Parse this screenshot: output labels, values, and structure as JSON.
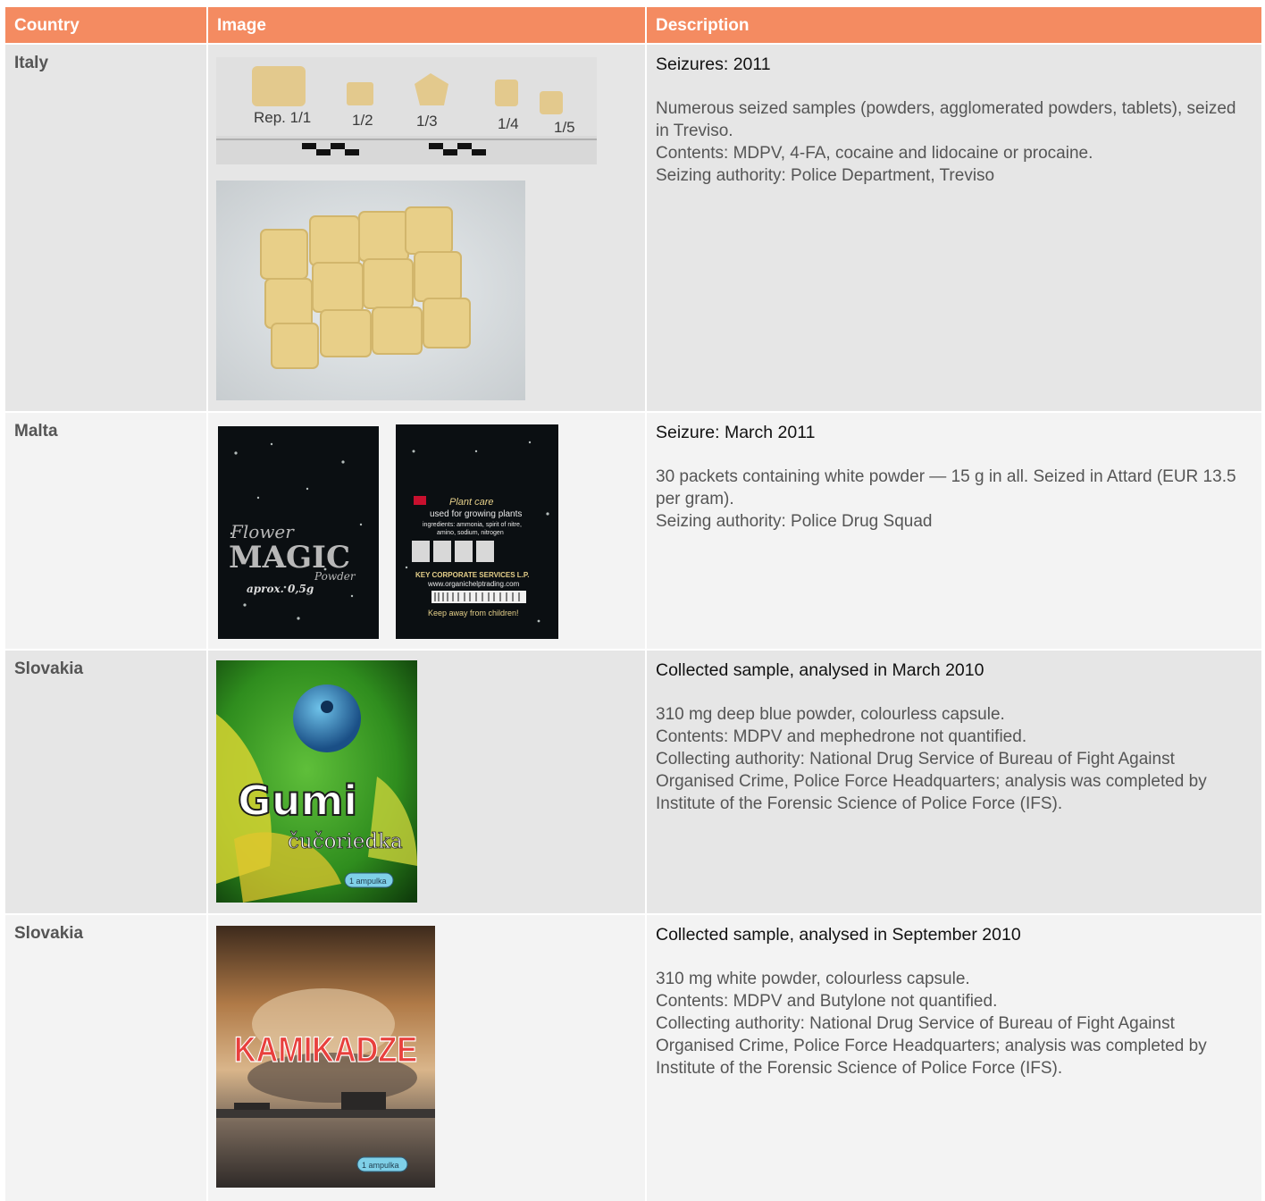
{
  "header": {
    "country": "Country",
    "image": "Image",
    "description": "Description"
  },
  "rows": [
    {
      "country": "Italy",
      "title": "Seizures: 2011",
      "body": "Numerous seized samples (powders, agglomerated powders, tablets), seized in Treviso.\nContents: MDPV, 4-FA, cocaine and lidocaine or procaine.\nSeizing authority: Police Department, Treviso",
      "images": {
        "labels": [
          "Rep. 1/1",
          "1/2",
          "1/3",
          "1/4",
          "1/5"
        ]
      }
    },
    {
      "country": "Malta",
      "title": "Seizure: March 2011",
      "body": "30 packets containing white powder — 15 g in all. Seized in Attard (EUR 13.5 per gram).\nSeizing authority: Police Drug Squad",
      "images": {
        "front_lines": [
          "Flower",
          "MAGIC",
          "Powder",
          "aprox. 0,5g"
        ],
        "back_lines": [
          "Plant care",
          "used for growing plants",
          "ingredients: ammonia, spirit of nitre,",
          "amino, sodium, nitrogen",
          "KEY CORPORATE SERVICES L.P.",
          "www.organichelptrading.com",
          "Keep away from children!"
        ]
      }
    },
    {
      "country": "Slovakia",
      "title": "Collected sample, analysed in March 2010",
      "body": "310 mg deep blue powder, colourless capsule.\nContents: MDPV and mephedrone not quantified.\nCollecting authority: National Drug Service of Bureau of Fight Against Organised Crime, Police Force Headquarters; analysis was completed by Institute of the Forensic Science of Police Force (IFS).",
      "images": {
        "brand": "Gumi",
        "sub": "čučoriedka",
        "pill": "1 ampulka"
      }
    },
    {
      "country": "Slovakia",
      "title": "Collected sample, analysed in September 2010",
      "body": "310 mg white powder, colourless capsule.\nContents: MDPV and Butylone not quantified.\nCollecting authority: National Drug Service of Bureau of Fight Against Organised Crime, Police Force Headquarters; analysis was completed by Institute of the Forensic Science of Police Force (IFS).",
      "images": {
        "brand": "KAMIKADZE",
        "pill": "1 ampulka"
      }
    }
  ]
}
